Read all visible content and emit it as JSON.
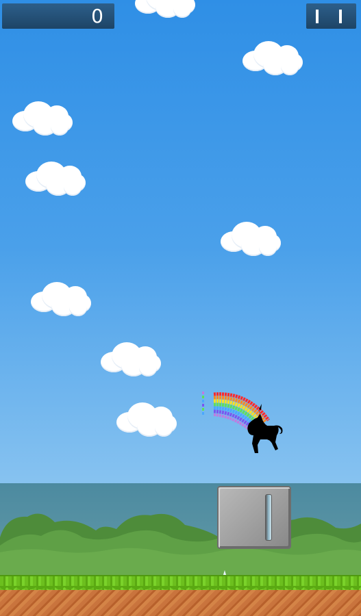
{
  "hud": {
    "score": "0"
  },
  "icons": {
    "pause": "pause-icon"
  },
  "colors": {
    "sky_top": "#2f8fe6",
    "sky_bottom": "#a9d4f2",
    "hud_panel": "#1d4466",
    "grass": "#6cbf1e",
    "dirt": "#c9743d",
    "obstacle": "#9c9c9c"
  },
  "rainbow_colors": [
    "#ff2a2a",
    "#ff8a1f",
    "#ffe31f",
    "#5fe05c",
    "#4aa8ff",
    "#7a56f0",
    "#c07ae0"
  ]
}
